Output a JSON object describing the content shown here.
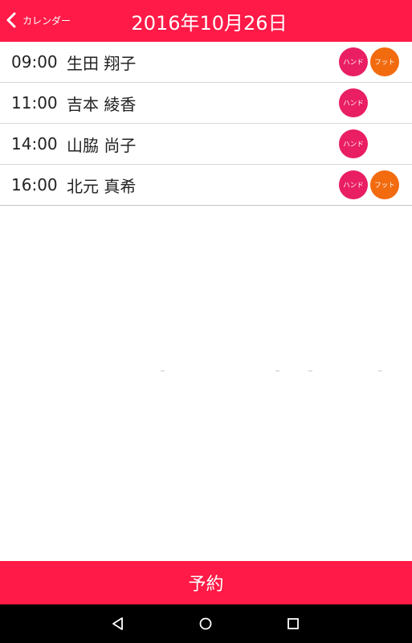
{
  "header": {
    "back_label": "カレンダー",
    "title": "2016年10月26日"
  },
  "appointments": [
    {
      "time": "09:00",
      "name": "生田 翔子",
      "badges": [
        {
          "type": "hand",
          "label": "ハンド"
        },
        {
          "type": "foot",
          "label": "フット"
        }
      ]
    },
    {
      "time": "11:00",
      "name": "吉本 綾香",
      "badges": [
        {
          "type": "hand",
          "label": "ハンド"
        }
      ]
    },
    {
      "time": "14:00",
      "name": "山脇 尚子",
      "badges": [
        {
          "type": "hand",
          "label": "ハンド"
        }
      ]
    },
    {
      "time": "16:00",
      "name": "北元 真希",
      "badges": [
        {
          "type": "hand",
          "label": "ハンド"
        },
        {
          "type": "foot",
          "label": "フット"
        }
      ]
    }
  ],
  "footer": {
    "reserve_label": "予約"
  },
  "colors": {
    "accent": "#ff1a47",
    "hand_badge": "#e91e63",
    "foot_badge": "#f26b0f"
  },
  "system_nav": [
    "back-icon",
    "home-icon",
    "recents-icon"
  ]
}
